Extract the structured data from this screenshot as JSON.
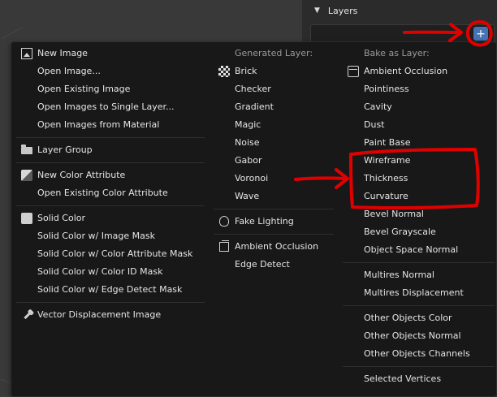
{
  "panel": {
    "layers_title": "Layers",
    "add_glyph": "+"
  },
  "menu": {
    "col1": {
      "items": [
        {
          "label": "New Image",
          "icon": "image-icon"
        },
        {
          "label": "Open Image..."
        },
        {
          "label": "Open Existing Image"
        },
        {
          "label": "Open Images to Single Layer..."
        },
        {
          "label": "Open Images from Material"
        },
        {
          "label": "Layer Group",
          "icon": "folder-icon"
        },
        {
          "label": "New Color Attribute",
          "icon": "color-attribute-icon"
        },
        {
          "label": "Open Existing Color Attribute"
        },
        {
          "label": "Solid Color",
          "icon": "solid-color-icon"
        },
        {
          "label": "Solid Color w/ Image Mask"
        },
        {
          "label": "Solid Color w/ Color Attribute Mask"
        },
        {
          "label": "Solid Color w/ Color ID Mask"
        },
        {
          "label": "Solid Color w/ Edge Detect Mask"
        },
        {
          "label": "Vector Displacement Image",
          "icon": "eyedropper-icon"
        }
      ]
    },
    "col2": {
      "header": "Generated Layer:",
      "items": [
        {
          "label": "Brick",
          "icon": "checker-icon"
        },
        {
          "label": "Checker"
        },
        {
          "label": "Gradient"
        },
        {
          "label": "Magic"
        },
        {
          "label": "Noise"
        },
        {
          "label": "Gabor"
        },
        {
          "label": "Voronoi"
        },
        {
          "label": "Wave"
        },
        {
          "label": "Fake Lighting",
          "icon": "lightbulb-icon"
        },
        {
          "label": "Ambient Occlusion",
          "icon": "cube-icon"
        },
        {
          "label": "Edge Detect"
        }
      ]
    },
    "col3": {
      "header": "Bake as Layer:",
      "items": [
        {
          "label": "Ambient Occlusion",
          "icon": "bake-icon"
        },
        {
          "label": "Pointiness"
        },
        {
          "label": "Cavity"
        },
        {
          "label": "Dust"
        },
        {
          "label": "Paint Base"
        },
        {
          "label": "Wireframe"
        },
        {
          "label": "Thickness"
        },
        {
          "label": "Curvature"
        },
        {
          "label": "Bevel Normal"
        },
        {
          "label": "Bevel Grayscale"
        },
        {
          "label": "Object Space Normal"
        },
        {
          "label": "Multires Normal"
        },
        {
          "label": "Multires Displacement"
        },
        {
          "label": "Other Objects Color"
        },
        {
          "label": "Other Objects Normal"
        },
        {
          "label": "Other Objects Channels"
        },
        {
          "label": "Selected Vertices"
        }
      ]
    }
  },
  "colors": {
    "menu_bg": "#181818",
    "text": "#e5e5e5",
    "header_text": "#9a9a9a",
    "accent_button": "#4772b3",
    "annotation_red": "#e00000"
  }
}
